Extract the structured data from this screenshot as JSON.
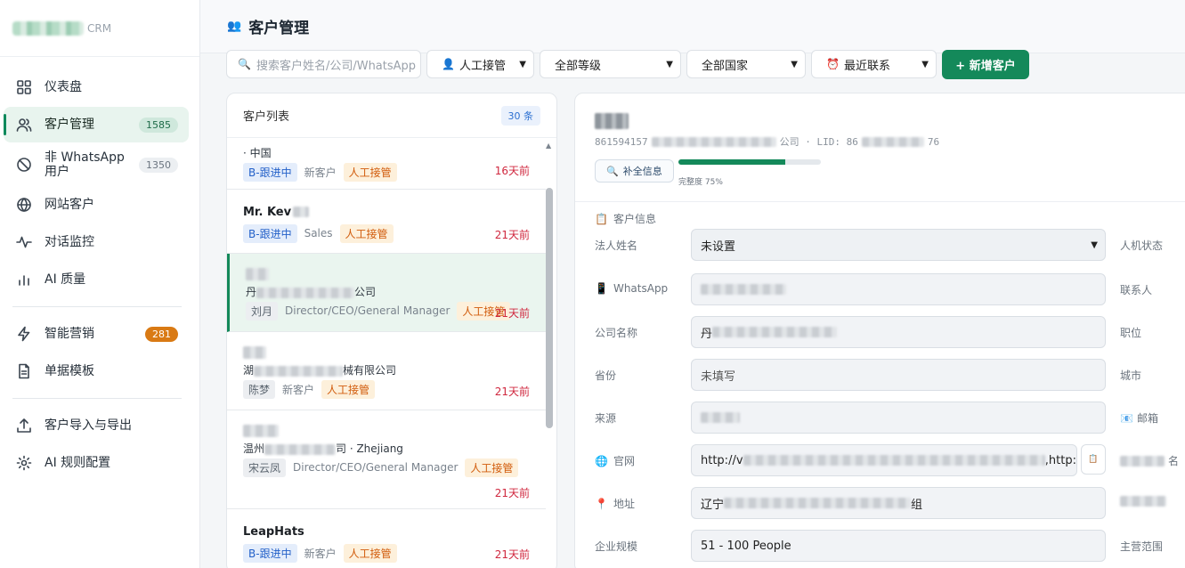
{
  "brand": {
    "suffix": "CRM"
  },
  "header": {
    "title": "客户管理"
  },
  "sidebar": {
    "items": [
      {
        "label": "仪表盘",
        "icon": "grid-icon"
      },
      {
        "label": "客户管理",
        "icon": "users-icon",
        "badge": "1585"
      },
      {
        "label": "非 WhatsApp 用户",
        "icon": "ban-icon",
        "badge": "1350"
      },
      {
        "label": "网站客户",
        "icon": "globe-icon"
      },
      {
        "label": "对话监控",
        "icon": "activity-icon"
      },
      {
        "label": "AI 质量",
        "icon": "bar-chart-icon"
      },
      {
        "label": "智能营销",
        "icon": "zap-icon",
        "badge": "281"
      },
      {
        "label": "单据模板",
        "icon": "document-icon"
      },
      {
        "label": "客户导入与导出",
        "icon": "upload-icon"
      },
      {
        "label": "AI 规则配置",
        "icon": "settings-icon"
      }
    ]
  },
  "filters": {
    "search_placeholder": "搜索客户姓名/公司/WhatsApp",
    "handler": "人工接管",
    "level": "全部等级",
    "country": "全部国家",
    "sort": "最近联系",
    "new_button": "+ 新增客户"
  },
  "list": {
    "title": "客户列表",
    "count": "30 条",
    "rows": [
      {
        "company": "· 中国",
        "stage": "B-跟进中",
        "role": "新客户",
        "handler": "人工接管",
        "days": "16天前"
      },
      {
        "name": "Mr. Kev",
        "stage": "B-跟进中",
        "role": "Sales",
        "handler": "人工接管",
        "days": "21天前"
      },
      {
        "company_prefix": "丹",
        "company_suffix": "公司",
        "owner": "刘月",
        "role": "Director/CEO/General Manager",
        "handler": "人工接管",
        "days": "21天前"
      },
      {
        "company_prefix": "湖",
        "company_suffix": "械有限公司",
        "owner": "陈梦",
        "role": "新客户",
        "handler": "人工接管",
        "days": "21天前"
      },
      {
        "company_prefix": "温州",
        "company_suffix": "司 · Zhejiang",
        "owner": "宋云凤",
        "role": "Director/CEO/General Manager",
        "handler": "人工接管",
        "days": "21天前"
      },
      {
        "name": "LeapHats",
        "stage": "B-跟进中",
        "role": "新客户",
        "handler": "人工接管",
        "days": "21天前"
      }
    ]
  },
  "detail": {
    "meta_prefix": "861594157",
    "meta_mid": "公司 · LID: 86",
    "meta_suffix": "76",
    "fill_button": "补全信息",
    "completion": 0.75,
    "completion_label": "完整度 75%",
    "section_title": "客户信息",
    "fields": {
      "legal_name": {
        "label": "法人姓名",
        "value": "未设置",
        "right": "人机状态"
      },
      "whatsapp": {
        "label": "WhatsApp",
        "right": "联系人"
      },
      "company": {
        "label": "公司名称",
        "value_prefix": "丹",
        "right": "职位"
      },
      "province": {
        "label": "省份",
        "value": "未填写",
        "right": "城市"
      },
      "source": {
        "label": "来源",
        "right": "邮箱"
      },
      "website": {
        "label": "官网",
        "value_prefix": "http://v",
        "value_suffix": ",http:",
        "right": "名"
      },
      "address": {
        "label": "地址",
        "value_prefix": "辽宁",
        "value_suffix": "组"
      },
      "scale": {
        "label": "企业规模",
        "value": "51 - 100 People",
        "right": "主营范围"
      }
    }
  },
  "colors": {
    "accent": "#14895a",
    "danger": "#d0283f",
    "warning": "#d15b0b"
  }
}
